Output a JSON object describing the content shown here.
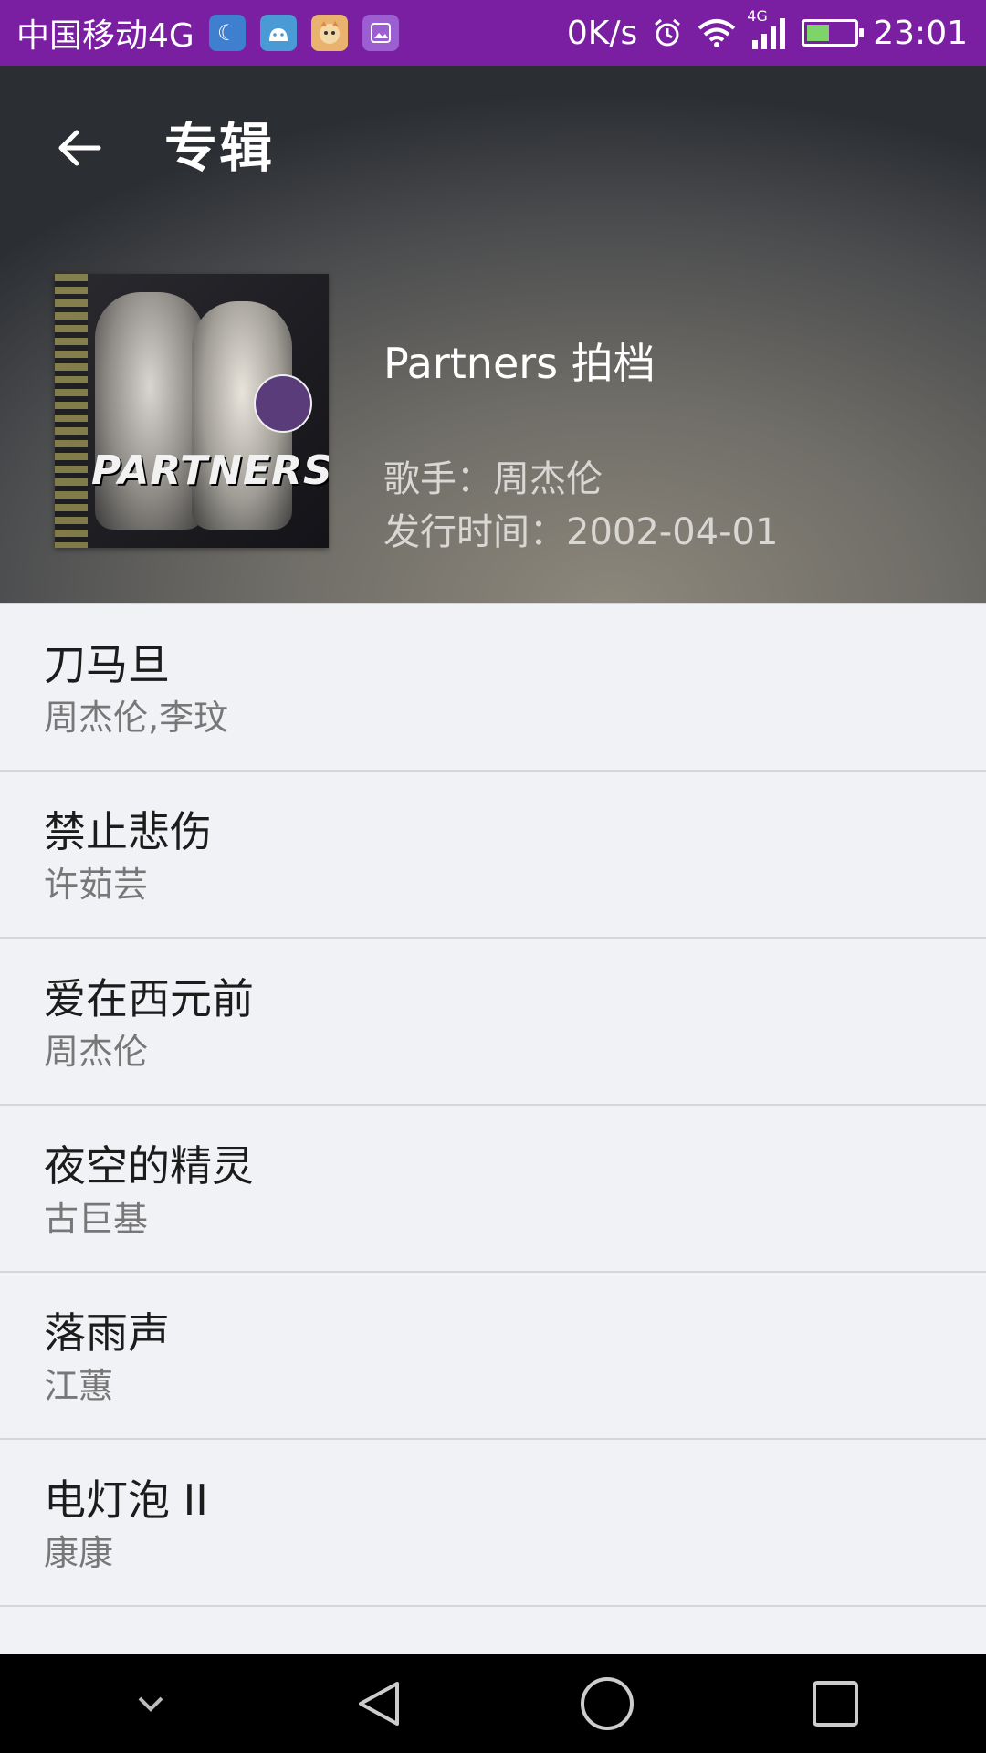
{
  "status_bar": {
    "carrier": "中国移动4G",
    "network_speed": "0K/s",
    "network_type": "4G",
    "time": "23:01",
    "notification_icons": [
      "moon-icon",
      "android-icon",
      "pet-app-icon",
      "gallery-icon"
    ],
    "battery_level": 0.42
  },
  "header": {
    "title": "专辑",
    "album_name": "Partners 拍档",
    "artist_line": "歌手：周杰伦",
    "release_line": "发行时间：2002-04-01",
    "cover_text": "PARTNERS"
  },
  "songs": [
    {
      "title": "刀马旦",
      "artist": "周杰伦,李玟"
    },
    {
      "title": "禁止悲伤",
      "artist": "许茹芸"
    },
    {
      "title": "爱在西元前",
      "artist": "周杰伦"
    },
    {
      "title": "夜空的精灵",
      "artist": "古巨基"
    },
    {
      "title": "落雨声",
      "artist": "江蕙"
    },
    {
      "title": "电灯泡 II",
      "artist": "康康"
    }
  ],
  "colors": {
    "status_bar": "#7a1fa2",
    "list_background": "#f1f2f5",
    "divider": "#d6d6d9"
  }
}
